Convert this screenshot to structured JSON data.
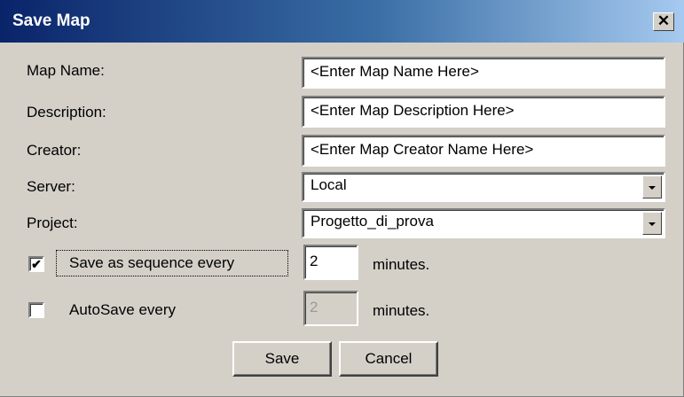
{
  "window": {
    "title": "Save Map",
    "close_glyph": "✕"
  },
  "form": {
    "map_name_label": "Map Name:",
    "map_name_value": "<Enter Map Name Here>",
    "description_label": "Description:",
    "description_value": "<Enter Map Description Here>",
    "creator_label": "Creator:",
    "creator_value": "<Enter Map Creator Name Here>",
    "server_label": "Server:",
    "server_selected": "Local",
    "project_label": "Project:",
    "project_selected": "Progetto_di_prova"
  },
  "options": {
    "sequence": {
      "checked": true,
      "check_glyph": "✔",
      "label": "Save as sequence every",
      "value": "2",
      "unit": "minutes."
    },
    "autosave": {
      "checked": false,
      "label": "AutoSave every",
      "value": "2",
      "unit": "minutes."
    }
  },
  "buttons": {
    "save_label": "Save",
    "cancel_label": "Cancel"
  },
  "colors": {
    "title_start": "#0a246a",
    "title_end": "#a6caf0",
    "face": "#d4d0c8"
  }
}
